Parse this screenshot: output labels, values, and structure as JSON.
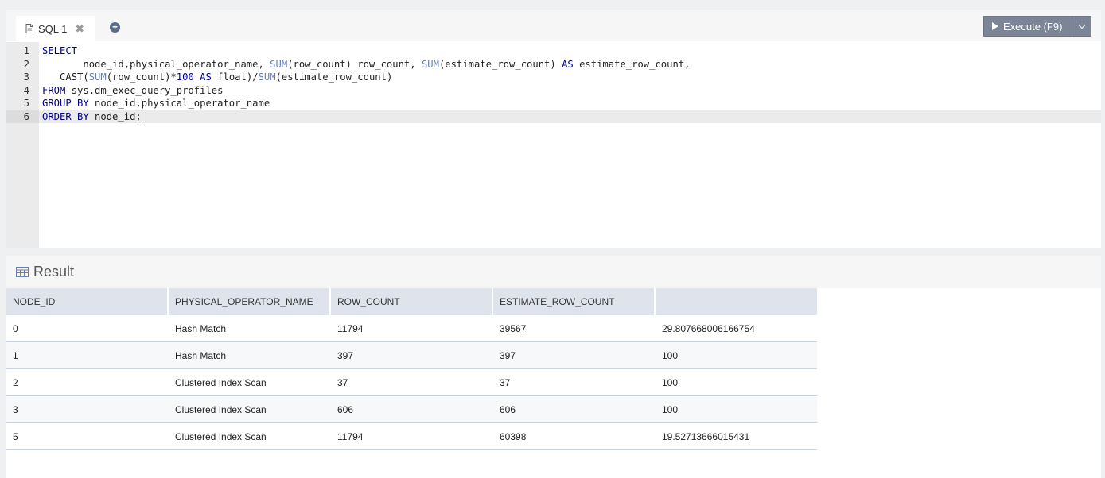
{
  "editor": {
    "tab_label": "SQL 1",
    "tab_close": "✖",
    "add_tab": "+",
    "execute_label": "Execute (F9)",
    "lines": [
      {
        "n": "1",
        "html": "<span class=\"kw\">SELECT</span>"
      },
      {
        "n": "2",
        "html": "       node_id,physical_operator_name, <span class=\"fn\">SUM</span>(row_count) row_count, <span class=\"fn\">SUM</span>(estimate_row_count) <span class=\"kw\">AS</span> estimate_row_count,"
      },
      {
        "n": "3",
        "html": "   CAST(<span class=\"fn\">SUM</span>(row_count)*<span class=\"num\">100</span> <span class=\"kw\">AS</span> float)/<span class=\"fn\">SUM</span>(estimate_row_count)"
      },
      {
        "n": "4",
        "html": "<span class=\"kw\">FROM</span> sys.dm_exec_query_profiles"
      },
      {
        "n": "5",
        "html": "<span class=\"kw\">GROUP BY</span> node_id,physical_operator_name"
      },
      {
        "n": "6",
        "html": "<span class=\"kw\">ORDER BY</span> node_id;"
      }
    ]
  },
  "result": {
    "title": "Result",
    "columns": [
      "NODE_ID",
      "PHYSICAL_OPERATOR_NAME",
      "ROW_COUNT",
      "ESTIMATE_ROW_COUNT",
      ""
    ],
    "rows": [
      [
        "0",
        "Hash Match",
        "11794",
        "39567",
        "29.807668006166754"
      ],
      [
        "1",
        "Hash Match",
        "397",
        "397",
        "100"
      ],
      [
        "2",
        "Clustered Index Scan",
        "37",
        "37",
        "100"
      ],
      [
        "3",
        "Clustered Index Scan",
        "606",
        "606",
        "100"
      ],
      [
        "5",
        "Clustered Index Scan",
        "11794",
        "60398",
        "19.52713666015431"
      ]
    ]
  },
  "colors": {
    "execute_button": "#7b8596",
    "header_row": "#dfe4ec",
    "keyword": "#00008b",
    "function": "#6a7fb3"
  }
}
